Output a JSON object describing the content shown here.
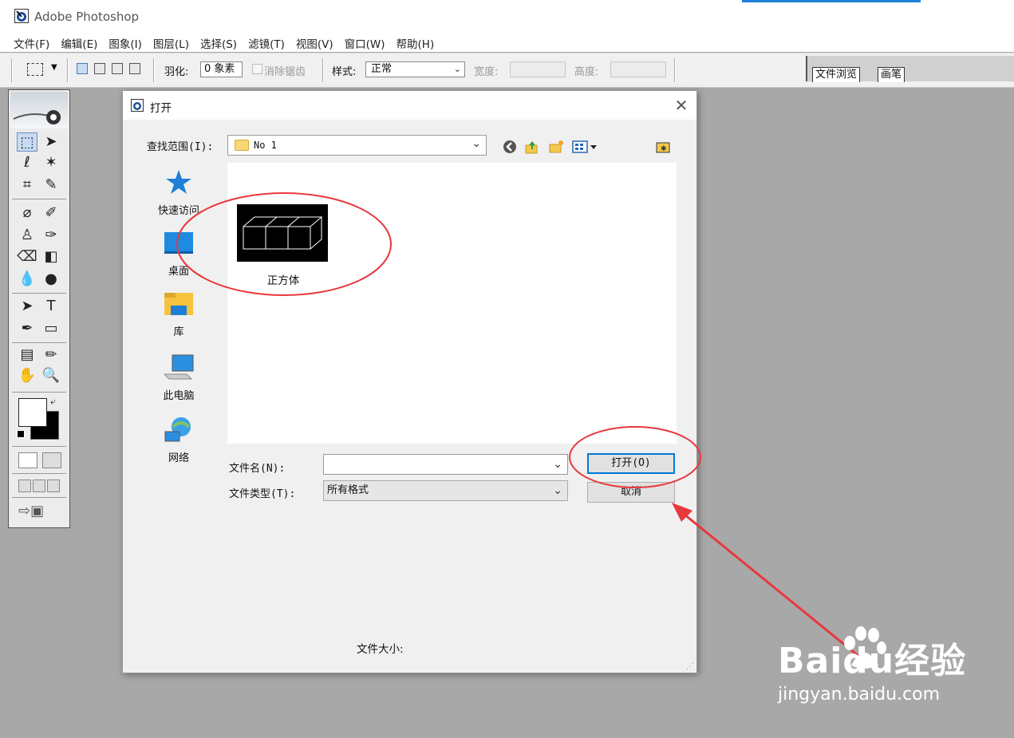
{
  "window": {
    "title": "Adobe Photoshop"
  },
  "menu": [
    "文件(F)",
    "编辑(E)",
    "图象(I)",
    "图层(L)",
    "选择(S)",
    "滤镜(T)",
    "视图(V)",
    "窗口(W)",
    "帮助(H)"
  ],
  "options": {
    "feather_label": "羽化:",
    "feather_value": "0 象素",
    "antialias_label": "消除锯齿",
    "style_label": "样式:",
    "style_value": "正常",
    "width_label": "宽度:",
    "height_label": "高度:"
  },
  "palette_well": {
    "tabs": [
      "文件浏览",
      "画笔"
    ]
  },
  "dialog": {
    "title": "打开",
    "look_in_label": "查找范围(I):",
    "look_in_value": "No 1",
    "places": [
      "快速访问",
      "桌面",
      "库",
      "此电脑",
      "网络"
    ],
    "file": {
      "name": "正方体"
    },
    "filename_label": "文件名(N):",
    "filename_value": "",
    "filetype_label": "文件类型(T):",
    "filetype_value": "所有格式",
    "open_button": "打开(O)",
    "cancel_button": "取消",
    "filesize_label": "文件大小:"
  },
  "watermark": {
    "logo": "Baidu经验",
    "url": "jingyan.baidu.com"
  },
  "colors": {
    "annotation": "#e8383d",
    "selection": "#c7dbf3",
    "accent": "#1e7fd8"
  }
}
